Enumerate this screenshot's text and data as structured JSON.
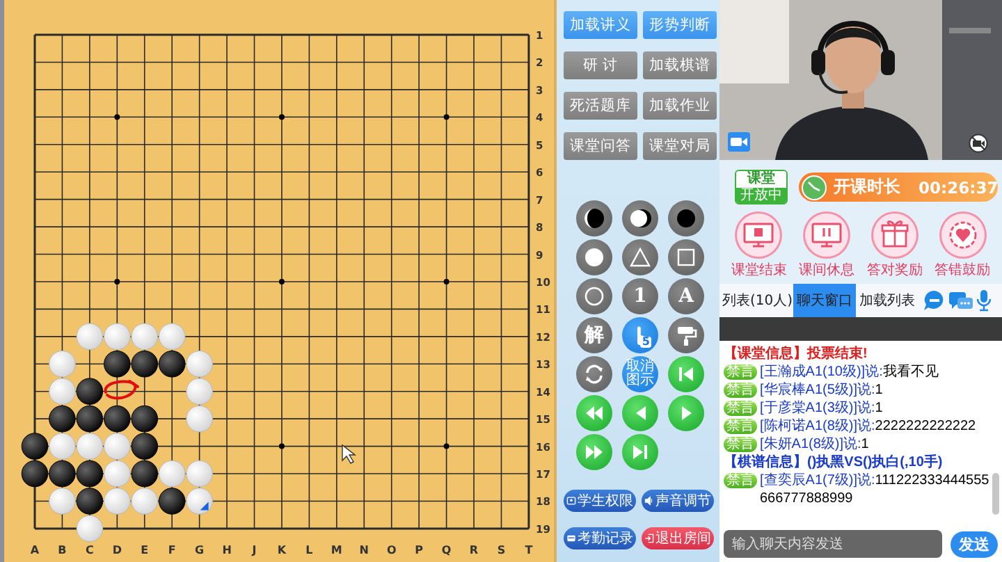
{
  "board": {
    "columns": [
      "A",
      "B",
      "C",
      "D",
      "E",
      "F",
      "G",
      "H",
      "J",
      "K",
      "L",
      "M",
      "N",
      "O",
      "P",
      "Q",
      "R",
      "S",
      "T"
    ],
    "rows": [
      "1",
      "2",
      "3",
      "4",
      "5",
      "6",
      "7",
      "8",
      "9",
      "10",
      "11",
      "12",
      "13",
      "14",
      "15",
      "16",
      "17",
      "18",
      "19"
    ],
    "grid": [
      [
        {
          "kind": "empty"
        },
        {
          "kind": "empty"
        },
        {
          "kind": "empty"
        },
        {
          "kind": "empty"
        },
        {
          "kind": "empty"
        },
        {
          "kind": "empty"
        },
        {
          "kind": "empty"
        },
        {
          "kind": "empty"
        },
        {
          "kind": "empty"
        },
        {
          "kind": "empty"
        },
        {
          "kind": "empty"
        },
        {
          "kind": "empty"
        },
        {
          "kind": "empty"
        },
        {
          "kind": "empty"
        },
        {
          "kind": "empty"
        },
        {
          "kind": "empty"
        },
        {
          "kind": "empty"
        },
        {
          "kind": "empty"
        },
        {
          "kind": "empty"
        }
      ],
      [
        {
          "kind": "empty"
        },
        {
          "kind": "empty"
        },
        {
          "kind": "empty"
        },
        {
          "kind": "empty"
        },
        {
          "kind": "empty"
        },
        {
          "kind": "empty"
        },
        {
          "kind": "empty"
        },
        {
          "kind": "empty"
        },
        {
          "kind": "empty"
        },
        {
          "kind": "empty"
        },
        {
          "kind": "empty"
        },
        {
          "kind": "empty"
        },
        {
          "kind": "empty"
        },
        {
          "kind": "empty"
        },
        {
          "kind": "empty"
        },
        {
          "kind": "empty"
        },
        {
          "kind": "empty"
        },
        {
          "kind": "empty"
        },
        {
          "kind": "empty"
        }
      ],
      [
        {
          "kind": "empty"
        },
        {
          "kind": "empty"
        },
        {
          "kind": "empty"
        },
        {
          "kind": "empty"
        },
        {
          "kind": "empty"
        },
        {
          "kind": "empty"
        },
        {
          "kind": "empty"
        },
        {
          "kind": "empty"
        },
        {
          "kind": "empty"
        },
        {
          "kind": "empty"
        },
        {
          "kind": "empty"
        },
        {
          "kind": "empty"
        },
        {
          "kind": "empty"
        },
        {
          "kind": "empty"
        },
        {
          "kind": "empty"
        },
        {
          "kind": "empty"
        },
        {
          "kind": "empty"
        },
        {
          "kind": "empty"
        },
        {
          "kind": "empty"
        }
      ],
      [
        {
          "kind": "empty"
        },
        {
          "kind": "empty"
        },
        {
          "kind": "empty"
        },
        {
          "kind": "empty"
        },
        {
          "kind": "empty"
        },
        {
          "kind": "empty"
        },
        {
          "kind": "empty"
        },
        {
          "kind": "empty"
        },
        {
          "kind": "empty"
        },
        {
          "kind": "empty"
        },
        {
          "kind": "empty"
        },
        {
          "kind": "empty"
        },
        {
          "kind": "empty"
        },
        {
          "kind": "empty"
        },
        {
          "kind": "empty"
        },
        {
          "kind": "empty"
        },
        {
          "kind": "empty"
        },
        {
          "kind": "empty"
        },
        {
          "kind": "empty"
        }
      ],
      [
        {
          "kind": "empty"
        },
        {
          "kind": "empty"
        },
        {
          "kind": "empty"
        },
        {
          "kind": "empty"
        },
        {
          "kind": "empty"
        },
        {
          "kind": "empty"
        },
        {
          "kind": "empty"
        },
        {
          "kind": "empty"
        },
        {
          "kind": "empty"
        },
        {
          "kind": "empty"
        },
        {
          "kind": "empty"
        },
        {
          "kind": "empty"
        },
        {
          "kind": "empty"
        },
        {
          "kind": "empty"
        },
        {
          "kind": "empty"
        },
        {
          "kind": "empty"
        },
        {
          "kind": "empty"
        },
        {
          "kind": "empty"
        },
        {
          "kind": "empty"
        }
      ],
      [
        {
          "kind": "empty"
        },
        {
          "kind": "empty"
        },
        {
          "kind": "empty"
        },
        {
          "kind": "empty"
        },
        {
          "kind": "empty"
        },
        {
          "kind": "empty"
        },
        {
          "kind": "empty"
        },
        {
          "kind": "empty"
        },
        {
          "kind": "empty"
        },
        {
          "kind": "empty"
        },
        {
          "kind": "empty"
        },
        {
          "kind": "empty"
        },
        {
          "kind": "empty"
        },
        {
          "kind": "empty"
        },
        {
          "kind": "empty"
        },
        {
          "kind": "empty"
        },
        {
          "kind": "empty"
        },
        {
          "kind": "empty"
        },
        {
          "kind": "empty"
        }
      ],
      [
        {
          "kind": "empty"
        },
        {
          "kind": "empty"
        },
        {
          "kind": "empty"
        },
        {
          "kind": "empty"
        },
        {
          "kind": "empty"
        },
        {
          "kind": "empty"
        },
        {
          "kind": "empty"
        },
        {
          "kind": "empty"
        },
        {
          "kind": "empty"
        },
        {
          "kind": "empty"
        },
        {
          "kind": "empty"
        },
        {
          "kind": "empty"
        },
        {
          "kind": "empty"
        },
        {
          "kind": "empty"
        },
        {
          "kind": "empty"
        },
        {
          "kind": "empty"
        },
        {
          "kind": "empty"
        },
        {
          "kind": "empty"
        },
        {
          "kind": "empty"
        }
      ],
      [
        {
          "kind": "empty"
        },
        {
          "kind": "empty"
        },
        {
          "kind": "empty"
        },
        {
          "kind": "empty"
        },
        {
          "kind": "empty"
        },
        {
          "kind": "empty"
        },
        {
          "kind": "empty"
        },
        {
          "kind": "empty"
        },
        {
          "kind": "empty"
        },
        {
          "kind": "empty"
        },
        {
          "kind": "empty"
        },
        {
          "kind": "empty"
        },
        {
          "kind": "empty"
        },
        {
          "kind": "empty"
        },
        {
          "kind": "empty"
        },
        {
          "kind": "empty"
        },
        {
          "kind": "empty"
        },
        {
          "kind": "empty"
        },
        {
          "kind": "empty"
        }
      ],
      [
        {
          "kind": "empty"
        },
        {
          "kind": "empty"
        },
        {
          "kind": "empty"
        },
        {
          "kind": "empty"
        },
        {
          "kind": "empty"
        },
        {
          "kind": "empty"
        },
        {
          "kind": "empty"
        },
        {
          "kind": "empty"
        },
        {
          "kind": "empty"
        },
        {
          "kind": "empty"
        },
        {
          "kind": "empty"
        },
        {
          "kind": "empty"
        },
        {
          "kind": "empty"
        },
        {
          "kind": "empty"
        },
        {
          "kind": "empty"
        },
        {
          "kind": "empty"
        },
        {
          "kind": "empty"
        },
        {
          "kind": "empty"
        },
        {
          "kind": "empty"
        }
      ],
      [
        {
          "kind": "empty"
        },
        {
          "kind": "empty"
        },
        {
          "kind": "empty"
        },
        {
          "kind": "empty"
        },
        {
          "kind": "empty"
        },
        {
          "kind": "empty"
        },
        {
          "kind": "empty"
        },
        {
          "kind": "empty"
        },
        {
          "kind": "empty"
        },
        {
          "kind": "empty"
        },
        {
          "kind": "empty"
        },
        {
          "kind": "empty"
        },
        {
          "kind": "empty"
        },
        {
          "kind": "empty"
        },
        {
          "kind": "empty"
        },
        {
          "kind": "empty"
        },
        {
          "kind": "empty"
        },
        {
          "kind": "empty"
        },
        {
          "kind": "empty"
        }
      ],
      [
        {
          "kind": "empty"
        },
        {
          "kind": "empty"
        },
        {
          "kind": "empty"
        },
        {
          "kind": "empty"
        },
        {
          "kind": "empty"
        },
        {
          "kind": "empty"
        },
        {
          "kind": "empty"
        },
        {
          "kind": "empty"
        },
        {
          "kind": "empty"
        },
        {
          "kind": "empty"
        },
        {
          "kind": "empty"
        },
        {
          "kind": "empty"
        },
        {
          "kind": "empty"
        },
        {
          "kind": "empty"
        },
        {
          "kind": "empty"
        },
        {
          "kind": "empty"
        },
        {
          "kind": "empty"
        },
        {
          "kind": "empty"
        },
        {
          "kind": "empty"
        }
      ],
      [
        {
          "kind": "empty"
        },
        {
          "kind": "empty"
        },
        {
          "kind": "white",
          "marked": false
        },
        {
          "kind": "white",
          "marked": false
        },
        {
          "kind": "white",
          "marked": false
        },
        {
          "kind": "white",
          "marked": false
        },
        {
          "kind": "empty"
        },
        {
          "kind": "empty"
        },
        {
          "kind": "empty"
        },
        {
          "kind": "empty"
        },
        {
          "kind": "empty"
        },
        {
          "kind": "empty"
        },
        {
          "kind": "empty"
        },
        {
          "kind": "empty"
        },
        {
          "kind": "empty"
        },
        {
          "kind": "empty"
        },
        {
          "kind": "empty"
        },
        {
          "kind": "empty"
        },
        {
          "kind": "empty"
        }
      ],
      [
        {
          "kind": "empty"
        },
        {
          "kind": "white",
          "marked": false
        },
        {
          "kind": "empty"
        },
        {
          "kind": "black",
          "marked": false
        },
        {
          "kind": "black",
          "marked": false
        },
        {
          "kind": "black",
          "marked": false
        },
        {
          "kind": "white",
          "marked": false
        },
        {
          "kind": "empty"
        },
        {
          "kind": "empty"
        },
        {
          "kind": "empty"
        },
        {
          "kind": "empty"
        },
        {
          "kind": "empty"
        },
        {
          "kind": "empty"
        },
        {
          "kind": "empty"
        },
        {
          "kind": "empty"
        },
        {
          "kind": "empty"
        },
        {
          "kind": "empty"
        },
        {
          "kind": "empty"
        },
        {
          "kind": "empty"
        }
      ],
      [
        {
          "kind": "empty"
        },
        {
          "kind": "white",
          "marked": false
        },
        {
          "kind": "black",
          "marked": false
        },
        {
          "kind": "empty"
        },
        {
          "kind": "empty"
        },
        {
          "kind": "empty"
        },
        {
          "kind": "white",
          "marked": false
        },
        {
          "kind": "empty"
        },
        {
          "kind": "empty"
        },
        {
          "kind": "empty"
        },
        {
          "kind": "empty"
        },
        {
          "kind": "empty"
        },
        {
          "kind": "empty"
        },
        {
          "kind": "empty"
        },
        {
          "kind": "empty"
        },
        {
          "kind": "empty"
        },
        {
          "kind": "empty"
        },
        {
          "kind": "empty"
        },
        {
          "kind": "empty"
        }
      ],
      [
        {
          "kind": "empty"
        },
        {
          "kind": "black",
          "marked": false
        },
        {
          "kind": "black",
          "marked": false
        },
        {
          "kind": "black",
          "marked": false
        },
        {
          "kind": "black",
          "marked": false
        },
        {
          "kind": "empty"
        },
        {
          "kind": "white",
          "marked": false
        },
        {
          "kind": "empty"
        },
        {
          "kind": "empty"
        },
        {
          "kind": "empty"
        },
        {
          "kind": "empty"
        },
        {
          "kind": "empty"
        },
        {
          "kind": "empty"
        },
        {
          "kind": "empty"
        },
        {
          "kind": "empty"
        },
        {
          "kind": "empty"
        },
        {
          "kind": "empty"
        },
        {
          "kind": "empty"
        },
        {
          "kind": "empty"
        }
      ],
      [
        {
          "kind": "black",
          "marked": false
        },
        {
          "kind": "white",
          "marked": false
        },
        {
          "kind": "white",
          "marked": false
        },
        {
          "kind": "white",
          "marked": false
        },
        {
          "kind": "black",
          "marked": false
        },
        {
          "kind": "empty"
        },
        {
          "kind": "empty"
        },
        {
          "kind": "empty"
        },
        {
          "kind": "empty"
        },
        {
          "kind": "empty"
        },
        {
          "kind": "empty"
        },
        {
          "kind": "empty"
        },
        {
          "kind": "empty"
        },
        {
          "kind": "empty"
        },
        {
          "kind": "empty"
        },
        {
          "kind": "empty"
        },
        {
          "kind": "empty"
        },
        {
          "kind": "empty"
        },
        {
          "kind": "empty"
        }
      ],
      [
        {
          "kind": "black",
          "marked": false
        },
        {
          "kind": "black",
          "marked": false
        },
        {
          "kind": "black",
          "marked": false
        },
        {
          "kind": "white",
          "marked": false
        },
        {
          "kind": "black",
          "marked": false
        },
        {
          "kind": "white",
          "marked": false
        },
        {
          "kind": "white",
          "marked": false
        },
        {
          "kind": "empty"
        },
        {
          "kind": "empty"
        },
        {
          "kind": "empty"
        },
        {
          "kind": "empty"
        },
        {
          "kind": "empty"
        },
        {
          "kind": "empty"
        },
        {
          "kind": "empty"
        },
        {
          "kind": "empty"
        },
        {
          "kind": "empty"
        },
        {
          "kind": "empty"
        },
        {
          "kind": "empty"
        },
        {
          "kind": "empty"
        }
      ],
      [
        {
          "kind": "empty"
        },
        {
          "kind": "white",
          "marked": false
        },
        {
          "kind": "black",
          "marked": false
        },
        {
          "kind": "white",
          "marked": false
        },
        {
          "kind": "white",
          "marked": false
        },
        {
          "kind": "black",
          "marked": false
        },
        {
          "kind": "white",
          "marked": true
        },
        {
          "kind": "empty"
        },
        {
          "kind": "empty"
        },
        {
          "kind": "empty"
        },
        {
          "kind": "empty"
        },
        {
          "kind": "empty"
        },
        {
          "kind": "empty"
        },
        {
          "kind": "empty"
        },
        {
          "kind": "empty"
        },
        {
          "kind": "empty"
        },
        {
          "kind": "empty"
        },
        {
          "kind": "empty"
        },
        {
          "kind": "empty"
        }
      ],
      [
        {
          "kind": "empty"
        },
        {
          "kind": "empty"
        },
        {
          "kind": "white",
          "marked": false
        },
        {
          "kind": "empty"
        },
        {
          "kind": "empty"
        },
        {
          "kind": "empty"
        },
        {
          "kind": "empty"
        },
        {
          "kind": "empty"
        },
        {
          "kind": "empty"
        },
        {
          "kind": "empty"
        },
        {
          "kind": "empty"
        },
        {
          "kind": "empty"
        },
        {
          "kind": "empty"
        },
        {
          "kind": "empty"
        },
        {
          "kind": "empty"
        },
        {
          "kind": "empty"
        },
        {
          "kind": "empty"
        },
        {
          "kind": "empty"
        },
        {
          "kind": "empty"
        }
      ]
    ]
  },
  "tool_panel": {
    "actions": [
      {
        "label": "加载讲义",
        "kind": "primary"
      },
      {
        "label": "形势判断",
        "kind": "primary"
      },
      {
        "label": "研 讨",
        "kind": "secondary"
      },
      {
        "label": "加载棋谱",
        "kind": "secondary"
      },
      {
        "label": "死活题库",
        "kind": "secondary"
      },
      {
        "label": "加载作业",
        "kind": "secondary"
      },
      {
        "label": "课堂问答",
        "kind": "secondary"
      },
      {
        "label": "课堂对局",
        "kind": "secondary"
      }
    ],
    "tools": [
      {
        "kind": "alternate",
        "active": false
      },
      {
        "kind": "alternate-white",
        "active": false
      },
      {
        "kind": "black",
        "active": false
      },
      {
        "kind": "white",
        "active": false
      },
      {
        "kind": "triangle",
        "active": false
      },
      {
        "kind": "square",
        "active": false
      },
      {
        "kind": "circle",
        "active": false
      },
      {
        "kind": "text",
        "label": "1",
        "active": false
      },
      {
        "kind": "text",
        "label": "A",
        "active": false
      },
      {
        "kind": "text",
        "label": "解",
        "active": false
      },
      {
        "kind": "hand",
        "label": "5",
        "active": true
      },
      {
        "kind": "roller",
        "active": false
      },
      {
        "kind": "refresh",
        "active": false
      },
      {
        "kind": "caption",
        "label": "取消图示",
        "active": true
      }
    ],
    "playback": [
      {
        "kind": "first"
      },
      {
        "kind": "rewind"
      },
      {
        "kind": "prev"
      },
      {
        "kind": "play"
      },
      {
        "kind": "forward"
      },
      {
        "kind": "last"
      }
    ],
    "footer_buttons": [
      {
        "label": "学生权限",
        "kind": "permission"
      },
      {
        "label": "声音调节",
        "kind": "volume"
      },
      {
        "label": "考勤记录",
        "kind": "attendance"
      },
      {
        "label": "退出房间",
        "kind": "exit"
      }
    ]
  },
  "class_status": {
    "badge_title": "课堂",
    "badge_status": "开放中",
    "timer_label": "开课时长",
    "timer": "00:26:37"
  },
  "class_actions": [
    {
      "label": "课堂结束",
      "kind": "stop"
    },
    {
      "label": "课间休息",
      "kind": "pause"
    },
    {
      "label": "答对奖励",
      "kind": "gift"
    },
    {
      "label": "答错鼓励",
      "kind": "flower"
    }
  ],
  "tabs": [
    {
      "label": "列表(10人)",
      "selected": false
    },
    {
      "label": "聊天窗口",
      "selected": true
    },
    {
      "label": "加载列表",
      "selected": false
    }
  ],
  "chat": [
    {
      "kind": "system",
      "text": "【课堂信息】投票结束!"
    },
    {
      "kind": "message",
      "badge": "禁言",
      "sender": "[王瀚成A1(10级)]说:",
      "text": "我看不见"
    },
    {
      "kind": "message",
      "badge": "禁言",
      "sender": "[华宸棒A1(5级)]说:",
      "text": "1"
    },
    {
      "kind": "message",
      "badge": "禁言",
      "sender": "[于彦棠A1(3级)]说:",
      "text": "1"
    },
    {
      "kind": "message",
      "badge": "禁言",
      "sender": "[陈柯诺A1(8级)]说:",
      "text": "2222222222222"
    },
    {
      "kind": "message",
      "badge": "禁言",
      "sender": "[朱妍A1(8级)]说:",
      "text": "1"
    },
    {
      "kind": "info",
      "text": "【棋谱信息】()执黑VS()执白(,10手)"
    },
    {
      "kind": "message",
      "badge": "禁言",
      "sender": "[查奕辰A1(7级)]说:",
      "text": "111222333444555666777888999"
    }
  ],
  "chat_input": {
    "placeholder": "输入聊天内容发送",
    "button": "发送"
  }
}
